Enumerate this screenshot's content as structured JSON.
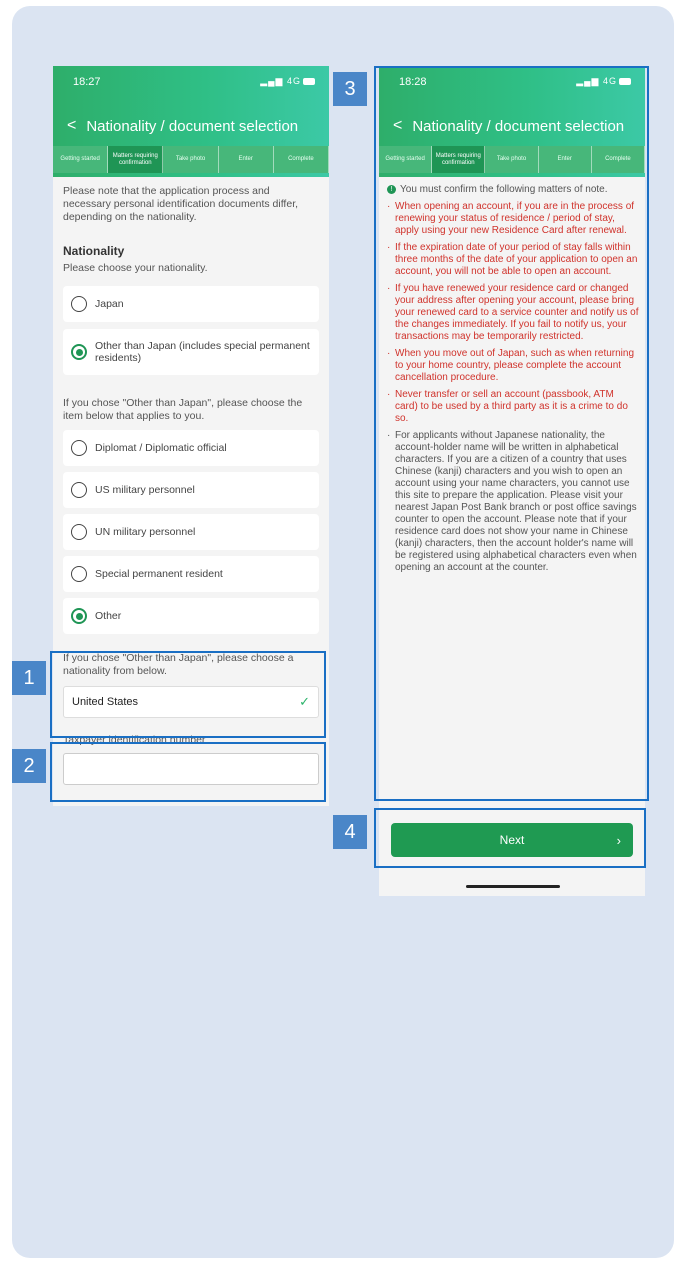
{
  "status_bar": {
    "time_left": "18:27",
    "time_right": "18:28",
    "signal": "4G"
  },
  "screen_title": "Nationality / document selection",
  "steps_left": [
    "Getting started",
    "Matters requiring confirmation",
    "Take photo",
    "Enter",
    "Complete"
  ],
  "steps_right": [
    "Getting started",
    "Matters requiring confirmation",
    "Take photo",
    "Enter",
    "Complete"
  ],
  "intro": "Please note that the application process and necessary personal identification documents differ, depending on the nationality.",
  "nationality": {
    "heading": "Nationality",
    "prompt": "Please choose your nationality.",
    "options": [
      "Japan",
      "Other than Japan (includes special permanent residents)"
    ],
    "selected_index": 1
  },
  "applies": {
    "prompt": "If you chose \"Other than Japan\", please choose the item below that applies to you.",
    "options": [
      "Diplomat / Diplomatic official",
      "US military personnel",
      "UN military personnel",
      "Special permanent resident",
      "Other"
    ],
    "selected_index": 4
  },
  "country": {
    "prompt": "If you chose \"Other than Japan\", please choose a nationality from below.",
    "value": "United States"
  },
  "tin": {
    "label": "Taxpayer identification number",
    "value": ""
  },
  "notice": {
    "heading": "You must confirm the following matters of note.",
    "items": [
      "When opening an account, if you are in the process of renewing your status of residence / period of stay, apply using your new Residence Card after renewal.",
      "If the expiration date of your period of stay falls within three months of the date of your application to open an account, you will not be able to open an account.",
      "If you have renewed your residence card or changed your address after opening your account, please bring your renewed card to a service counter and notify us of the changes immediately. If you fail to notify us, your transactions may be temporarily restricted.",
      "When you move out of Japan, such as when returning to your home country, please complete the account cancellation procedure.",
      "Never transfer or sell an account (passbook, ATM card) to be used by a third party as it is a crime to do so.",
      "For applicants without Japanese nationality, the account-holder name will be written in alphabetical characters. If you are a citizen of a country that uses Chinese (kanji) characters and you wish to open an account using your name characters, you cannot use this site to prepare the application. Please visit your nearest Japan Post Bank branch or post office savings counter to open the account. Please note that if your residence card does not show your name in Chinese (kanji) characters, then the account holder's name will be registered using alphabetical characters even when opening an account at the counter."
    ]
  },
  "next_label": "Next",
  "callouts": [
    "1",
    "2",
    "3",
    "4"
  ],
  "colors": {
    "accent_green": "#1f9a52",
    "callout_blue": "#1a6fc4",
    "warning_red": "#d0332c"
  }
}
